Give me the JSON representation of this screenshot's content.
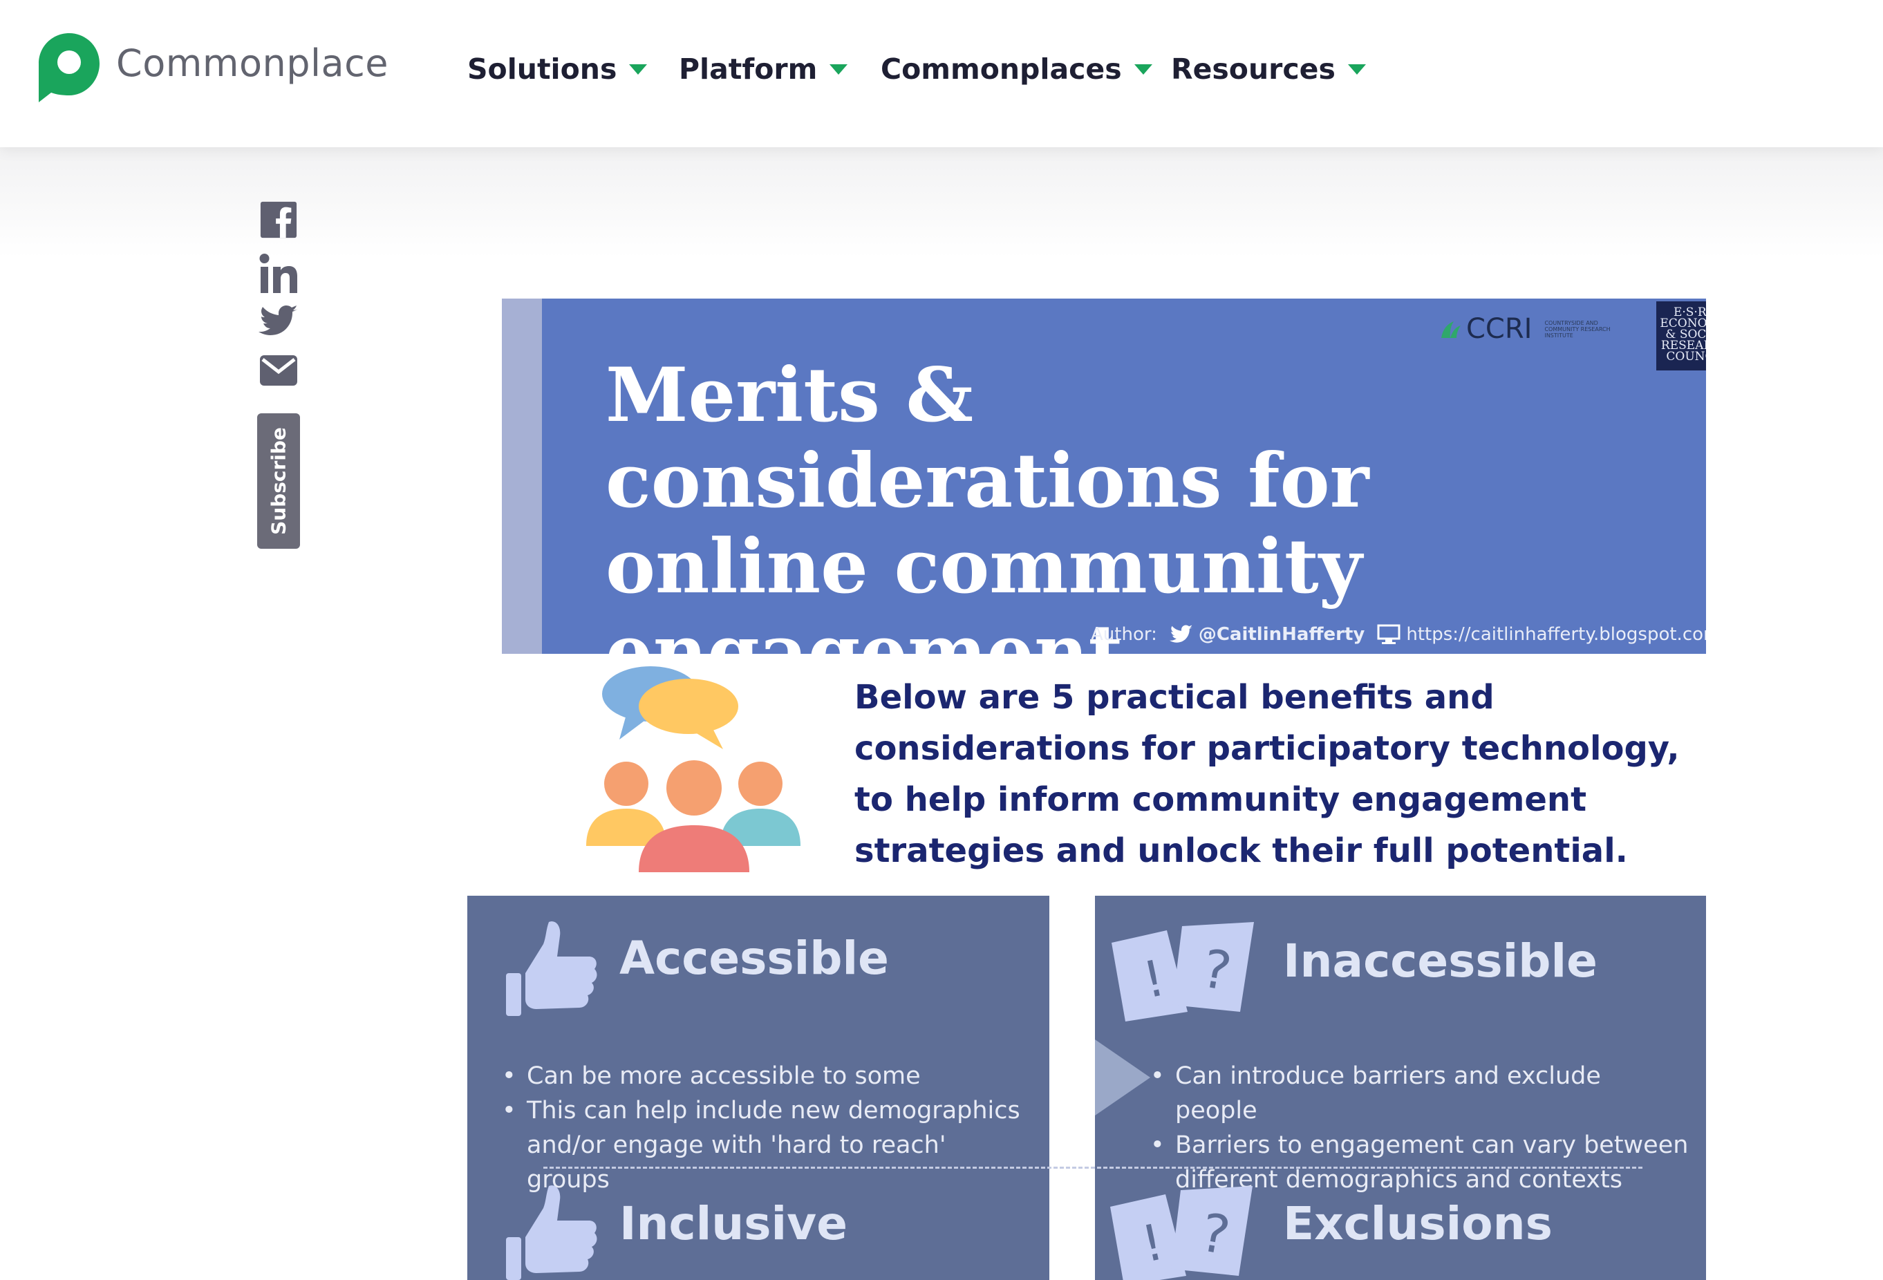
{
  "header": {
    "brand": "Commonplace",
    "brand_color": "#1aa55c",
    "nav": [
      {
        "label": "Solutions"
      },
      {
        "label": "Platform"
      },
      {
        "label": "Commonplaces"
      },
      {
        "label": "Resources"
      }
    ]
  },
  "share": {
    "icons": [
      "facebook-icon",
      "linkedin-icon",
      "twitter-icon",
      "email-icon"
    ],
    "subscribe_label": "Subscribe"
  },
  "infographic": {
    "title": "Merits & considerations for online community engagement",
    "ccri": "CCRI",
    "ccri_small": "COUNTRYSIDE AND COMMUNITY RESEARCH INSTITUTE",
    "esrc": "E·S·R·C ECONOMIC & SOCIAL RESEARCH COUNCIL",
    "author_label": "Author:",
    "author_handle": "@CaitlinHafferty",
    "author_url": "https://caitlinhafferty.blogspot.com",
    "intro": "Below are 5 practical benefits and considerations for participatory technology, to help inform community engagement strategies and unlock their full potential.",
    "left": {
      "heading1": "Accessible",
      "bullets": [
        "Can be more accessible to some",
        "This can help include new demographics and/or engage with 'hard to reach' groups"
      ],
      "heading2": "Inclusive"
    },
    "right": {
      "heading1": "Inaccessible",
      "bullets": [
        "Can introduce barriers and exclude people",
        "Barriers to engagement can vary between different demographics and contexts"
      ],
      "heading2": "Exclusions"
    }
  }
}
